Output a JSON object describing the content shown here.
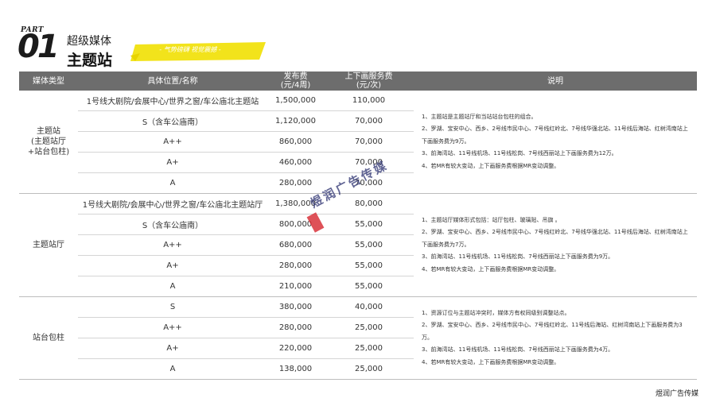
{
  "header": {
    "part": "PART",
    "number": "01",
    "subtitle": "超级媒体",
    "title": "主题站",
    "banner": "- 气势磅礴 视觉震撼 -"
  },
  "table": {
    "columns": [
      "媒体类型",
      "具体位置/名称",
      "发布费\n(元/4周)",
      "上下画服务费\n(元/次)",
      "说明"
    ],
    "groups": [
      {
        "type": "主题站\n(主题站厅\n+站台包柱)",
        "rows": [
          [
            "1号线大剧院/会展中心/世界之窗/车公庙北主题站",
            "1,500,000",
            "110,000"
          ],
          [
            "S（含车公庙南）",
            "1,120,000",
            "70,000"
          ],
          [
            "A++",
            "860,000",
            "70,000"
          ],
          [
            "A+",
            "460,000",
            "70,000"
          ],
          [
            "A",
            "280,000",
            "70,000"
          ]
        ],
        "notes": [
          "1、主题站是主题站厅和当站站台包柱的组合。",
          "2、罗湖、宝安中心、西乡、2号线市民中心、7号线红岭北、7号线华强北站、11号线后海站、红树湾南站上下画服务费为9万。",
          "3、前海湾站、11号线机场、11号线松岗、7号线西丽站上下画服务费为12万。",
          "4、若MR有较大变动，上下画服务费根据MR变动调整。"
        ]
      },
      {
        "type": "主题站厅",
        "rows": [
          [
            "1号线大剧院/会展中心/世界之窗/车公庙北主题站厅",
            "1,380,000",
            "80,000"
          ],
          [
            "S（含车公庙南）",
            "800,000",
            "55,000"
          ],
          [
            "A++",
            "680,000",
            "55,000"
          ],
          [
            "A+",
            "280,000",
            "55,000"
          ],
          [
            "A",
            "210,000",
            "55,000"
          ]
        ],
        "notes": [
          "1、主题站厅媒体形式包括：站厅包柱、玻璃贴、吊旗 。",
          "2、罗湖、宝安中心、西乡、2号线市民中心、7号线红岭北、7号线华强北站、11号线后海站、红树湾南站上下画服务费为7万。",
          "3、前海湾站、11号线机场、11号线松岗、7号线西丽站上下画服务费为9万。",
          "4、若MR有较大变动，上下画服务费根据MR变动调整。"
        ]
      },
      {
        "type": "站台包柱",
        "rows": [
          [
            "S",
            "380,000",
            "40,000"
          ],
          [
            "A++",
            "280,000",
            "25,000"
          ],
          [
            "A+",
            "220,000",
            "25,000"
          ],
          [
            "A",
            "138,000",
            "25,000"
          ]
        ],
        "notes": [
          "1、资源订位与主题站冲突时，媒体方有权同级别调整站点。",
          "2、罗湖、宝安中心、西乡、2号线市民中心、7号线红岭北、11号线后海站、红树湾南站上下画服务费为3万。",
          "3、前海湾站、11号线机场、11号线松岗、7号线西丽站上下画服务费为4万。",
          "4、若MR有较大变动，上下画服务费根据MR变动调整。"
        ]
      }
    ]
  },
  "watermark": "煜润广告传媒",
  "footer": "煜润广告传媒"
}
